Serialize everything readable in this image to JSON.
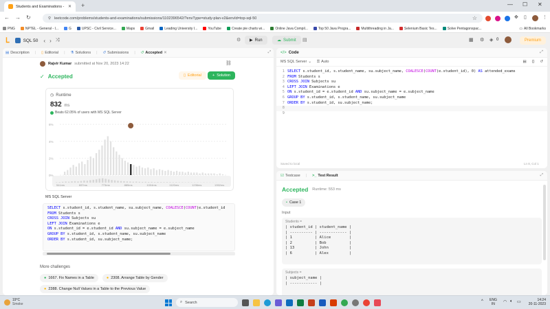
{
  "browser": {
    "tab_title": "Students and Examinations - Le",
    "url": "leetcode.com/problems/students-and-examinations/submissions/1102396542/?envType=study-plan-v2&envId=top-sql-50",
    "bookmarks": [
      "PNG",
      "NPTEL - General - I...",
      "G",
      "UPSC - Civil Service...",
      "Maps",
      "Gmail",
      "Leading University I...",
      "YouTube",
      "Create pie charts wi...",
      "Online Java Compil...",
      "Top 50 Java Progra...",
      "Multithreading in Ja...",
      "Selenium Basic Tes...",
      "Solve Pentagonspac..."
    ],
    "all_bookmarks": "All Bookmarks"
  },
  "lcnav": {
    "study_plan": "SQL 50",
    "run": "Run",
    "submit": "Submit",
    "count": "0",
    "premium": "Premium"
  },
  "left": {
    "tabs": [
      "Description",
      "Editorial",
      "Solutions",
      "Submissions",
      "Accepted"
    ],
    "user": "Rajvir Kumar",
    "submitted": "submitted at Nov 20, 2023 14:22",
    "status": "Accepted",
    "editorial_btn": "Editorial",
    "solution_btn": "Solution",
    "runtime_label": "Runtime",
    "runtime_value": "832",
    "runtime_unit": "ms",
    "beats": "Beats 62.05% of users with MS SQL Server",
    "y_ticks": [
      "6%",
      "4%",
      "2%",
      "0%"
    ],
    "x_ticks": [
      "541ms",
      "657ms",
      "773ms",
      "889ms",
      "1004ms",
      "1120ms",
      "1236ms",
      "1352ms"
    ],
    "lang": "MS SQL Server",
    "code": [
      "SELECT s.student_id, s.student_name, su.subject_name, COALESCE(COUNT(e.student_id",
      "FROM Students s",
      "CROSS JOIN Subjects su",
      "LEFT JOIN Examinations e",
      "ON s.student_id = e.student_id AND su.subject_name = e.subject_name",
      "GROUP BY s.student_id, s.student_name, su.subject_name",
      "ORDER BY s.student_id, su.subject_name;"
    ],
    "more_challenges": "More challenges",
    "challenges": [
      "1667. Fix Names in a Table",
      "2308. Arrange Table by Gender",
      "2388. Change Null Values in a Table to the Previous Value"
    ]
  },
  "code_panel": {
    "title": "Code",
    "lang": "MS SQL Server",
    "auto": "Auto",
    "lines": [
      "SELECT s.student_id, s.student_name, su.subject_name, COALESCE(COUNT(e.student_id), 0) AS attended_exams",
      "FROM Students s",
      "CROSS JOIN Subjects su",
      "LEFT JOIN Examinations e",
      "ON s.student_id = e.student_id AND su.subject_name = e.subject_name",
      "GROUP BY s.student_id, s.student_name, su.subject_name",
      "ORDER BY s.student_id, su.subject_name;",
      "",
      ""
    ],
    "line_numbers": [
      "1",
      "2",
      "3",
      "4",
      "5",
      "6",
      "7",
      "8",
      "9"
    ],
    "saved": "Saved to local",
    "cursor": "Ln 8, Col 1"
  },
  "result_panel": {
    "tab_testcase": "Testcase",
    "tab_result": "Test Result",
    "status": "Accepted",
    "runtime": "Runtime: 553 ms",
    "case": "Case 1",
    "input_label": "Input",
    "students_label": "Students =",
    "students_table": [
      "| student_id | student_name |",
      "| ---------- | ------------ |",
      "| 1          | Alice        |",
      "| 2          | Bob          |",
      "| 13         | John         |",
      "| 6          | Alex         |"
    ],
    "subjects_label": "Subjects =",
    "subjects_table": [
      "| subject_name |",
      "| ------------ |"
    ]
  },
  "taskbar": {
    "weather_temp": "19°C",
    "weather_desc": "Smoke",
    "search": "Search",
    "lang1": "ENG",
    "lang2": "IN",
    "time": "14:24",
    "date": "20-11-2023"
  },
  "chart_data": {
    "type": "bar",
    "ylabel": "",
    "xlabel": "",
    "x_ticks": [
      "541ms",
      "657ms",
      "773ms",
      "889ms",
      "1004ms",
      "1120ms",
      "1236ms",
      "1352ms"
    ],
    "y_ticks": [
      "0%",
      "2%",
      "4%",
      "6%"
    ],
    "ylim": [
      0,
      6.5
    ],
    "values": [
      0.4,
      0.6,
      0.9,
      1.2,
      1.0,
      1.4,
      1.6,
      1.3,
      1.8,
      2.2,
      2.0,
      2.6,
      3.0,
      3.5,
      4.2,
      4.6,
      4.0,
      3.3,
      2.8,
      2.4,
      2.0,
      1.7,
      1.5,
      1.3,
      1.2,
      1.0,
      1.1,
      0.9,
      0.8,
      0.9,
      0.7,
      0.8,
      0.6,
      0.7,
      0.6,
      0.5,
      0.6,
      0.5,
      0.4,
      0.5,
      0.4,
      0.4,
      0.3,
      0.4,
      0.3,
      0.3,
      0.3,
      0.2,
      0.3,
      0.2,
      0.2,
      0.2,
      0.2,
      0.1,
      0.2,
      0.1
    ],
    "highlight_index": 23,
    "grid": true
  }
}
